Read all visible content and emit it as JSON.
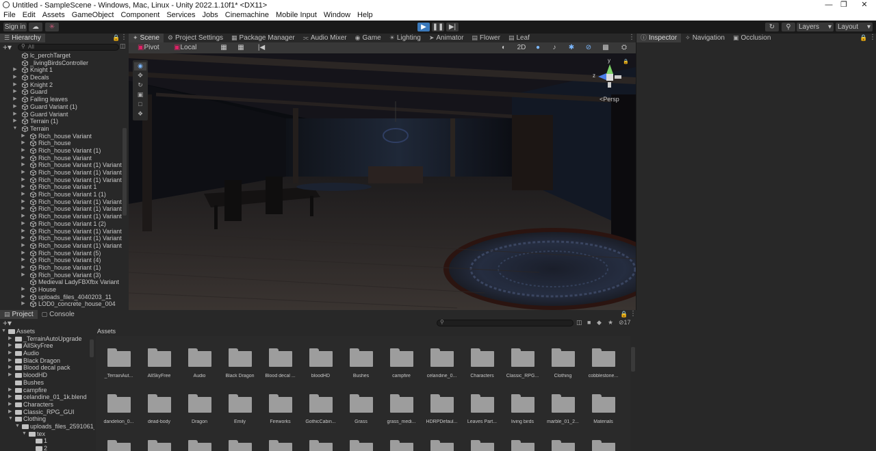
{
  "window": {
    "title": "Untitled - SampleScene - Windows, Mac, Linux - Unity 2022.1.10f1* <DX11>"
  },
  "menu": [
    "File",
    "Edit",
    "Assets",
    "GameObject",
    "Component",
    "Services",
    "Jobs",
    "Cinemachine",
    "Mobile Input",
    "Window",
    "Help"
  ],
  "toolbar": {
    "sign_in": "Sign in",
    "layers": "Layers",
    "layout": "Layout"
  },
  "hierarchy": {
    "tab": "Hierarchy",
    "search_placeholder": "All",
    "items": [
      {
        "label": "lc_perchTarget",
        "depth": 1,
        "expand": "none"
      },
      {
        "label": "_livingBirdsController",
        "depth": 1,
        "expand": "none"
      },
      {
        "label": "Knight 1",
        "depth": 1,
        "expand": "closed",
        "blue": false
      },
      {
        "label": "Decals",
        "depth": 1,
        "expand": "closed"
      },
      {
        "label": "Knight 2",
        "depth": 1,
        "expand": "closed"
      },
      {
        "label": "Guard",
        "depth": 1,
        "expand": "closed"
      },
      {
        "label": "Falling leaves",
        "depth": 1,
        "expand": "closed"
      },
      {
        "label": "Guard Variant (1)",
        "depth": 1,
        "expand": "closed"
      },
      {
        "label": "Guard Variant",
        "depth": 1,
        "expand": "closed"
      },
      {
        "label": "Terrain (1)",
        "depth": 1,
        "expand": "closed"
      },
      {
        "label": "Terrain",
        "depth": 1,
        "expand": "open"
      },
      {
        "label": "Rich_house Variant",
        "depth": 2,
        "expand": "closed"
      },
      {
        "label": "Rich_house",
        "depth": 2,
        "expand": "closed"
      },
      {
        "label": "Rich_house Variant (1)",
        "depth": 2,
        "expand": "closed"
      },
      {
        "label": "Rich_house Variant",
        "depth": 2,
        "expand": "closed"
      },
      {
        "label": "Rich_house Variant (1) Variant",
        "depth": 2,
        "expand": "closed"
      },
      {
        "label": "Rich_house Variant (1) Variant (",
        "depth": 2,
        "expand": "closed"
      },
      {
        "label": "Rich_house Variant (1) Variant (",
        "depth": 2,
        "expand": "closed"
      },
      {
        "label": "Rich_house Variant 1",
        "depth": 2,
        "expand": "closed"
      },
      {
        "label": "Rich_house Variant 1 (1)",
        "depth": 2,
        "expand": "closed"
      },
      {
        "label": "Rich_house Variant (1) Variant (",
        "depth": 2,
        "expand": "closed"
      },
      {
        "label": "Rich_house Variant (1) Variant (",
        "depth": 2,
        "expand": "closed"
      },
      {
        "label": "Rich_house Variant (1) Variant (",
        "depth": 2,
        "expand": "closed"
      },
      {
        "label": "Rich_house Variant 1 (2)",
        "depth": 2,
        "expand": "closed"
      },
      {
        "label": "Rich_house Variant (1) Variant (",
        "depth": 2,
        "expand": "closed"
      },
      {
        "label": "Rich_house Variant (1) Variant (",
        "depth": 2,
        "expand": "closed"
      },
      {
        "label": "Rich_house Variant (1) Variant (",
        "depth": 2,
        "expand": "closed"
      },
      {
        "label": "Rich_house Variant (5)",
        "depth": 2,
        "expand": "closed"
      },
      {
        "label": "Rich_house Variant (4)",
        "depth": 2,
        "expand": "closed"
      },
      {
        "label": "Rich_house Variant (1)",
        "depth": 2,
        "expand": "closed"
      },
      {
        "label": "Rich_house Variant (3)",
        "depth": 2,
        "expand": "closed"
      },
      {
        "label": "Medieval LadyFBXfbx Variant",
        "depth": 2,
        "expand": "none"
      },
      {
        "label": "House",
        "depth": 2,
        "expand": "closed"
      },
      {
        "label": "uploads_files_4040203_11",
        "depth": 2,
        "expand": "closed"
      },
      {
        "label": "LOD0_concrete_house_004",
        "depth": 2,
        "expand": "closed"
      }
    ]
  },
  "scene": {
    "tabs": [
      "Scene",
      "Project Settings",
      "Package Manager",
      "Audio Mixer",
      "Game",
      "Lighting",
      "Animator",
      "Flower",
      "Leaf"
    ],
    "pivot": "Pivot",
    "local": "Local",
    "mode_2d": "2D",
    "persp": "<Persp",
    "gizmo_y": "y",
    "gizmo_z": "z"
  },
  "inspector": {
    "tabs": [
      "Inspector",
      "Navigation",
      "Occlusion"
    ]
  },
  "project": {
    "tabs": [
      "Project",
      "Console"
    ],
    "hidden_count": "17",
    "breadcrumb": "Assets",
    "tree": [
      {
        "label": "Assets",
        "depth": 0,
        "expand": "open"
      },
      {
        "label": "_TerrainAutoUpgrade",
        "depth": 1,
        "expand": "closed"
      },
      {
        "label": "AllSkyFree",
        "depth": 1,
        "expand": "closed"
      },
      {
        "label": "Audio",
        "depth": 1,
        "expand": "closed"
      },
      {
        "label": "Black Dragon",
        "depth": 1,
        "expand": "closed"
      },
      {
        "label": "Blood decal pack",
        "depth": 1,
        "expand": "closed"
      },
      {
        "label": "bloodHD",
        "depth": 1,
        "expand": "closed"
      },
      {
        "label": "Bushes",
        "depth": 1,
        "expand": "none"
      },
      {
        "label": "campfire",
        "depth": 1,
        "expand": "closed"
      },
      {
        "label": "celandine_01_1k.blend",
        "depth": 1,
        "expand": "closed"
      },
      {
        "label": "Characters",
        "depth": 1,
        "expand": "closed"
      },
      {
        "label": "Classic_RPG_GUI",
        "depth": 1,
        "expand": "closed"
      },
      {
        "label": "Clothing",
        "depth": 1,
        "expand": "open"
      },
      {
        "label": "uploads_files_2591061_",
        "depth": 2,
        "expand": "open"
      },
      {
        "label": "tex",
        "depth": 3,
        "expand": "open"
      },
      {
        "label": "1",
        "depth": 4,
        "expand": "none"
      },
      {
        "label": "2",
        "depth": 4,
        "expand": "none"
      }
    ],
    "assets": [
      "_TerrainAut...",
      "AllSkyFree",
      "Audio",
      "Black Dragon",
      "Blood decal ...",
      "bloodHD",
      "Bushes",
      "campfire",
      "celandine_0...",
      "Characters",
      "Classic_RPG...",
      "Clothing",
      "cobblestone...",
      "dandelion_0...",
      "dead-body",
      "Dragon",
      "Emily",
      "Fireworks",
      "GothicCabin...",
      "Grass",
      "grass_medi...",
      "HDRPDefaul...",
      "Leaves Part...",
      "living birds",
      "marble_01_2...",
      "Materials",
      "",
      "",
      "",
      "",
      "",
      "",
      "",
      "",
      "",
      "",
      "",
      "",
      ""
    ]
  }
}
